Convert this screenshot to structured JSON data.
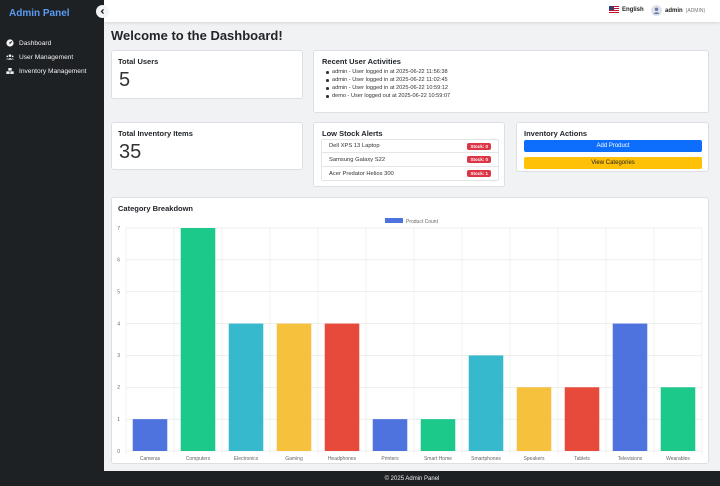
{
  "sidebar": {
    "brand": "Admin Panel",
    "items": [
      {
        "label": "Dashboard",
        "icon": "dashboard-icon"
      },
      {
        "label": "User Management",
        "icon": "users-icon"
      },
      {
        "label": "Inventory Management",
        "icon": "boxes-icon"
      }
    ]
  },
  "topbar": {
    "language": "English",
    "user_name": "admin",
    "user_role": "(ADMIN)"
  },
  "main": {
    "welcome": "Welcome to the Dashboard!",
    "total_users": {
      "title": "Total Users",
      "value": "5"
    },
    "recent_activities": {
      "title": "Recent User Activities",
      "items": [
        "admin - User logged in at 2025-06-22 11:56:38",
        "admin - User logged in at 2025-06-22 11:02:45",
        "admin - User logged in at 2025-06-22 10:59:12",
        "demo - User logged out at 2025-06-22 10:59:07"
      ]
    },
    "total_inventory": {
      "title": "Total Inventory Items",
      "value": "35"
    },
    "low_stock": {
      "title": "Low Stock Alerts",
      "items": [
        {
          "name": "Dell XPS 13 Laptop",
          "badge": "Stock: 0"
        },
        {
          "name": "Samsung Galaxy S22",
          "badge": "Stock: 0"
        },
        {
          "name": "Acer Predator Helios 300",
          "badge": "Stock: 1"
        }
      ]
    },
    "inventory_actions": {
      "title": "Inventory Actions",
      "add_product": "Add Product",
      "view_categories": "View Categories"
    },
    "category_breakdown": {
      "title": "Category Breakdown"
    }
  },
  "chart_data": {
    "type": "bar",
    "legend": "Product Count",
    "categories": [
      "Cameras",
      "Computers",
      "Electronics",
      "Gaming",
      "Headphones",
      "Printers",
      "Smart Home",
      "Smartphones",
      "Speakers",
      "Tablets",
      "Televisions",
      "Wearables"
    ],
    "values": [
      1,
      7,
      4,
      4,
      4,
      1,
      1,
      3,
      2,
      2,
      4,
      2
    ],
    "colors": [
      "#4e73df",
      "#1cc88a",
      "#36b9cc",
      "#f6c23e",
      "#e74a3b",
      "#4e73df",
      "#1cc88a",
      "#36b9cc",
      "#f6c23e",
      "#e74a3b",
      "#4e73df",
      "#1cc88a"
    ],
    "ylim": [
      0,
      7
    ],
    "yticks": [
      0,
      1,
      2,
      3,
      4,
      5,
      6,
      7
    ],
    "grid": true,
    "legend_position": "top"
  },
  "footer": "© 2025 Admin Panel"
}
